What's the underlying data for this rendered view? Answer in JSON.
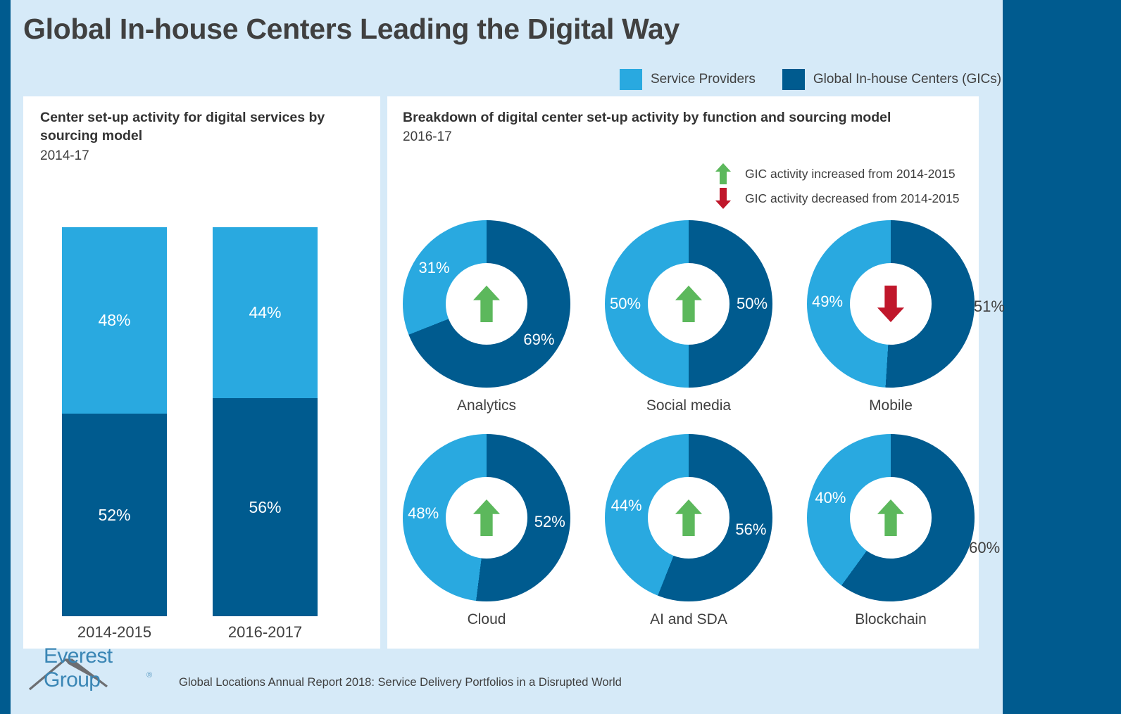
{
  "title": "Global In-house Centers Leading the Digital Way",
  "colors": {
    "service_providers": "#29a9e0",
    "gics": "#005b8f",
    "background": "#d6eaf8",
    "increase_green": "#5cb85c",
    "decrease_red": "#c0172b"
  },
  "legend": {
    "items": [
      {
        "label": "Service Providers",
        "color": "#29a9e0",
        "key": "sp"
      },
      {
        "label": "Global In-house Centers (GICs)",
        "color": "#005b8f",
        "key": "gic"
      }
    ]
  },
  "left_panel": {
    "title": "Center set-up activity for digital services by sourcing model",
    "subtitle": "2014-17"
  },
  "right_panel": {
    "title": "Breakdown of digital center set-up activity by function and sourcing model",
    "subtitle": "2016-17",
    "arrow_legend": [
      {
        "icon": "arrow-up-icon",
        "label": "GIC activity increased from 2014-2015"
      },
      {
        "icon": "arrow-down-icon",
        "label": "GIC activity decreased from 2014-2015"
      }
    ]
  },
  "footer": {
    "logo_text": "Everest Group",
    "logo_tm": "®",
    "caption": "Global Locations Annual Report 2018: Service Delivery Portfolios in a Disrupted World"
  },
  "chart_data": [
    {
      "type": "bar",
      "title": "Center set-up activity for digital services by sourcing model",
      "subtitle": "2014-17",
      "stacked": true,
      "normalized_percent": true,
      "categories": [
        "2014-2015",
        "2016-2017"
      ],
      "series": [
        {
          "name": "Service Providers",
          "color": "#29a9e0",
          "values": [
            48,
            44
          ],
          "labels": [
            "48%",
            "44%"
          ]
        },
        {
          "name": "Global In-house Centers (GICs)",
          "color": "#005b8f",
          "values": [
            52,
            56
          ],
          "labels": [
            "52%",
            "56%"
          ]
        }
      ],
      "ylim": [
        0,
        100
      ],
      "ylabel": "",
      "xlabel": "",
      "grid": false,
      "legend_position": "top"
    },
    {
      "type": "pie",
      "variant": "donut",
      "title": "Breakdown of digital center set-up activity by function and sourcing model",
      "subtitle": "2016-17",
      "legend_position": "top",
      "series_names": [
        "Global In-house Centers (GICs)",
        "Service Providers"
      ],
      "donuts": [
        {
          "category": "Analytics",
          "gic": 69,
          "sp": 31,
          "gic_label": "69%",
          "sp_label": "31%",
          "gic_label_position": "inside",
          "sp_label_position": "inside",
          "trend": "up",
          "trend_icon": "arrow-up-icon"
        },
        {
          "category": "Social media",
          "gic": 50,
          "sp": 50,
          "gic_label": "50%",
          "sp_label": "50%",
          "gic_label_position": "inside",
          "sp_label_position": "inside",
          "trend": "up",
          "trend_icon": "arrow-up-icon"
        },
        {
          "category": "Mobile",
          "gic": 51,
          "sp": 49,
          "gic_label": "51%",
          "sp_label": "49%",
          "gic_label_position": "outside",
          "sp_label_position": "inside",
          "trend": "down",
          "trend_icon": "arrow-down-icon"
        },
        {
          "category": "Cloud",
          "gic": 52,
          "sp": 48,
          "gic_label": "52%",
          "sp_label": "48%",
          "gic_label_position": "inside",
          "sp_label_position": "inside",
          "trend": "up",
          "trend_icon": "arrow-up-icon"
        },
        {
          "category": "AI and SDA",
          "gic": 56,
          "sp": 44,
          "gic_label": "56%",
          "sp_label": "44%",
          "gic_label_position": "inside",
          "sp_label_position": "inside",
          "trend": "up",
          "trend_icon": "arrow-up-icon"
        },
        {
          "category": "Blockchain",
          "gic": 60,
          "sp": 40,
          "gic_label": "60%",
          "sp_label": "40%",
          "gic_label_position": "outside",
          "sp_label_position": "inside",
          "trend": "up",
          "trend_icon": "arrow-up-icon"
        }
      ]
    }
  ]
}
